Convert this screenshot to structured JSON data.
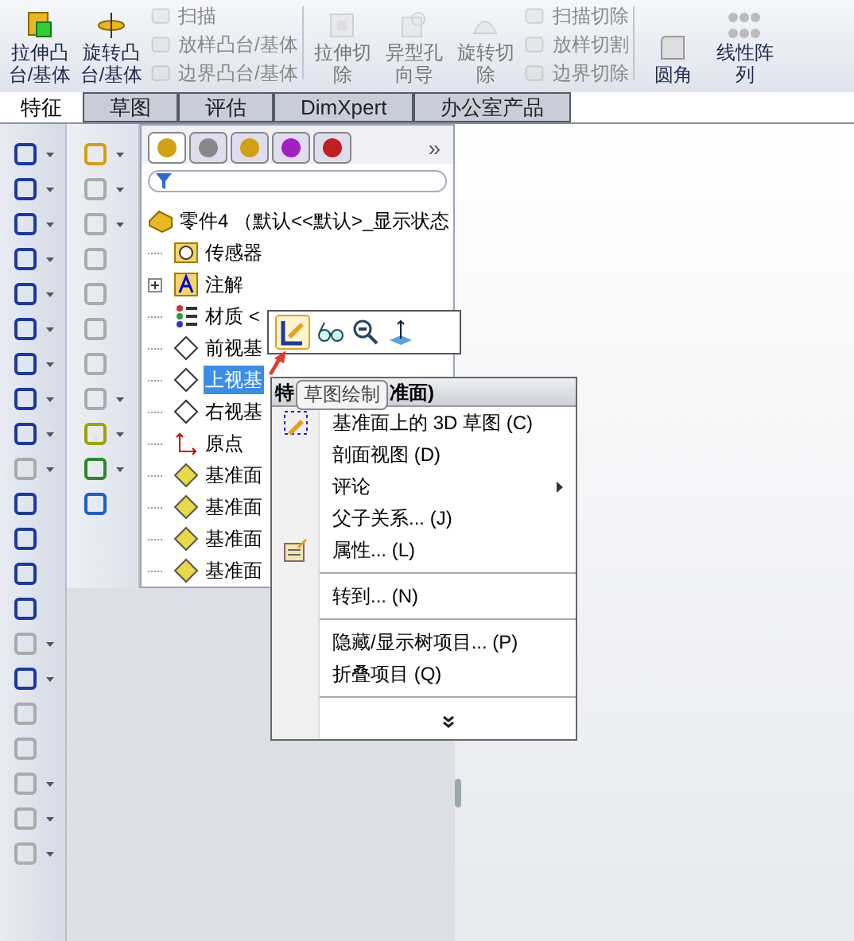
{
  "ribbon": {
    "large_left": [
      {
        "label": "拉伸凸台/基体",
        "kind": "extrude-boss",
        "disabled": false
      },
      {
        "label": "旋转凸台/基体",
        "kind": "revolve-boss",
        "disabled": false
      }
    ],
    "small_left": [
      {
        "label": "扫描",
        "disabled": true
      },
      {
        "label": "放样凸台/基体",
        "disabled": true
      },
      {
        "label": "边界凸台/基体",
        "disabled": true
      }
    ],
    "large_mid": [
      {
        "label": "拉伸切除",
        "kind": "extrude-cut",
        "disabled": true
      },
      {
        "label": "异型孔向导",
        "kind": "hole",
        "disabled": true
      },
      {
        "label": "旋转切除",
        "kind": "revolve-cut",
        "disabled": true
      }
    ],
    "small_mid": [
      {
        "label": "扫描切除",
        "disabled": true
      },
      {
        "label": "放样切割",
        "disabled": true
      },
      {
        "label": "边界切除",
        "disabled": true
      }
    ],
    "large_right": [
      {
        "label": "圆角",
        "kind": "fillet",
        "disabled": false
      },
      {
        "label": "线性阵列",
        "kind": "pattern",
        "disabled": false
      }
    ]
  },
  "tabs": [
    {
      "label": "特征",
      "selected": true
    },
    {
      "label": "草图",
      "selected": false
    },
    {
      "label": "评估",
      "selected": false
    },
    {
      "label": "DimXpert",
      "selected": false
    },
    {
      "label": "办公室产品",
      "selected": false
    }
  ],
  "tree_panel": {
    "more": "»",
    "root": "零件4 （默认<<默认>_显示状态",
    "items": [
      {
        "label": "传感器",
        "kind": "sensor",
        "selected": false,
        "expandable": false
      },
      {
        "label": "注解",
        "kind": "annotation",
        "selected": false,
        "expandable": true
      },
      {
        "label": "材质 <",
        "kind": "material",
        "selected": false,
        "expandable": false
      },
      {
        "label": "前视基",
        "kind": "plane",
        "selected": false,
        "expandable": false
      },
      {
        "label": "上视基",
        "kind": "plane",
        "selected": true,
        "expandable": false
      },
      {
        "label": "右视基",
        "kind": "plane",
        "selected": false,
        "expandable": false
      },
      {
        "label": "原点",
        "kind": "origin",
        "selected": false,
        "expandable": false
      },
      {
        "label": "基准面",
        "kind": "ref-plane",
        "selected": false,
        "expandable": false
      },
      {
        "label": "基准面",
        "kind": "ref-plane",
        "selected": false,
        "expandable": false
      },
      {
        "label": "基准面",
        "kind": "ref-plane",
        "selected": false,
        "expandable": false
      },
      {
        "label": "基准面",
        "kind": "ref-plane",
        "selected": false,
        "expandable": false
      }
    ]
  },
  "tooltip": "草图绘制",
  "context_menu": {
    "header_left": "特",
    "header_right": "准面)",
    "items": [
      {
        "kind": "item",
        "label": "基准面上的 3D 草图 (C)",
        "submenu": false
      },
      {
        "kind": "item",
        "label": "剖面视图 (D)",
        "submenu": false
      },
      {
        "kind": "item",
        "label": "评论",
        "submenu": true
      },
      {
        "kind": "item",
        "label": "父子关系... (J)",
        "submenu": false
      },
      {
        "kind": "item",
        "label": "属性... (L)",
        "submenu": false
      },
      {
        "kind": "separator"
      },
      {
        "kind": "item",
        "label": "转到... (N)",
        "submenu": false
      },
      {
        "kind": "separator"
      },
      {
        "kind": "item",
        "label": "隐藏/显示树项目... (P)",
        "submenu": false
      },
      {
        "kind": "item",
        "label": "折叠项目 (Q)",
        "submenu": false
      },
      {
        "kind": "separator"
      },
      {
        "kind": "more"
      }
    ]
  }
}
